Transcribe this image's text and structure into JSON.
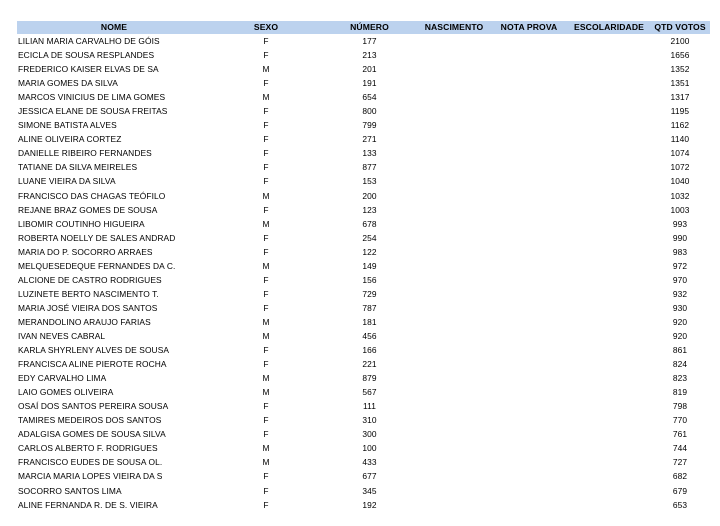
{
  "table": {
    "columns": [
      "NOME",
      "SEXO",
      "NÚMERO",
      "NASCIMENTO",
      "NOTA PROVA",
      "ESCOLARIDADE",
      "QTD VOTOS"
    ],
    "rows": [
      [
        "LILIAN MARIA CARVALHO DE GÓIS",
        "F",
        "177",
        "",
        "",
        "",
        "2100"
      ],
      [
        "ECICLA DE SOUSA RESPLANDES",
        "F",
        "213",
        "",
        "",
        "",
        "1656"
      ],
      [
        "FREDERICO KAISER ELVAS DE SA",
        "M",
        "201",
        "",
        "",
        "",
        "1352"
      ],
      [
        "MARIA GOMES DA SILVA",
        "F",
        "191",
        "",
        "",
        "",
        "1351"
      ],
      [
        "MARCOS VINICIUS DE LIMA GOMES",
        "M",
        "654",
        "",
        "",
        "",
        "1317"
      ],
      [
        "JESSICA ELANE DE SOUSA FREITAS",
        "F",
        "800",
        "",
        "",
        "",
        "1195"
      ],
      [
        "SIMONE BATISTA ALVES",
        "F",
        "799",
        "",
        "",
        "",
        "1162"
      ],
      [
        "ALINE OLIVEIRA CORTEZ",
        "F",
        "271",
        "",
        "",
        "",
        "1140"
      ],
      [
        "DANIELLE RIBEIRO FERNANDES",
        "F",
        "133",
        "",
        "",
        "",
        "1074"
      ],
      [
        "TATIANE DA SILVA MEIRELES",
        "F",
        "877",
        "",
        "",
        "",
        "1072"
      ],
      [
        "LUANE VIEIRA DA SILVA",
        "F",
        "153",
        "",
        "",
        "",
        "1040"
      ],
      [
        "FRANCISCO DAS CHAGAS TEÓFILO",
        "M",
        "200",
        "",
        "",
        "",
        "1032"
      ],
      [
        "REJANE BRAZ GOMES DE SOUSA",
        "F",
        "123",
        "",
        "",
        "",
        "1003"
      ],
      [
        "LIBOMIR COUTINHO HIGUEIRA",
        "M",
        "678",
        "",
        "",
        "",
        "993"
      ],
      [
        "ROBERTA NOELLY DE SALES ANDRAD",
        "F",
        "254",
        "",
        "",
        "",
        "990"
      ],
      [
        "MARIA DO P. SOCORRO ARRAES",
        "F",
        "122",
        "",
        "",
        "",
        "983"
      ],
      [
        "MELQUESEDEQUE FERNANDES DA C.",
        "M",
        "149",
        "",
        "",
        "",
        "972"
      ],
      [
        "ALCIONE DE CASTRO RODRIGUES",
        "F",
        "156",
        "",
        "",
        "",
        "970"
      ],
      [
        "LUZINETE BERTO NASCIMENTO T.",
        "F",
        "729",
        "",
        "",
        "",
        "932"
      ],
      [
        "MARIA JOSÉ VIEIRA DOS SANTOS",
        "F",
        "787",
        "",
        "",
        "",
        "930"
      ],
      [
        "MERANDOLINO ARAUJO FARIAS",
        "M",
        "181",
        "",
        "",
        "",
        "920"
      ],
      [
        "IVAN NEVES CABRAL",
        "M",
        "456",
        "",
        "",
        "",
        "920"
      ],
      [
        "KARLA SHYRLENY ALVES DE SOUSA",
        "F",
        "166",
        "",
        "",
        "",
        "861"
      ],
      [
        "FRANCISCA ALINE PIEROTE ROCHA",
        "F",
        "221",
        "",
        "",
        "",
        "824"
      ],
      [
        "EDY CARVALHO LIMA",
        "M",
        "879",
        "",
        "",
        "",
        "823"
      ],
      [
        "LAIO GOMES OLIVEIRA",
        "M",
        "567",
        "",
        "",
        "",
        "819"
      ],
      [
        "OSAÍ DOS SANTOS PEREIRA SOUSA",
        "F",
        "111",
        "",
        "",
        "",
        "798"
      ],
      [
        "TAMIRES MEDEIROS DOS SANTOS",
        "F",
        "310",
        "",
        "",
        "",
        "770"
      ],
      [
        "ADALGISA GOMES DE SOUSA SILVA",
        "F",
        "300",
        "",
        "",
        "",
        "761"
      ],
      [
        "CARLOS ALBERTO F. RODRIGUES",
        "M",
        "100",
        "",
        "",
        "",
        "744"
      ],
      [
        "FRANCISCO EUDES DE SOUSA OL.",
        "M",
        "433",
        "",
        "",
        "",
        "727"
      ],
      [
        "MARCIA MARIA LOPES VIEIRA DA S",
        "F",
        "677",
        "",
        "",
        "",
        "682"
      ],
      [
        "SOCORRO SANTOS LIMA",
        "F",
        "345",
        "",
        "",
        "",
        "679"
      ],
      [
        "ALINE FERNANDA R. DE S. VIEIRA",
        "F",
        "192",
        "",
        "",
        "",
        "653"
      ]
    ]
  },
  "colors": {
    "header_background": "#bcd2ee",
    "text": "#000000",
    "page_background": "#ffffff"
  }
}
